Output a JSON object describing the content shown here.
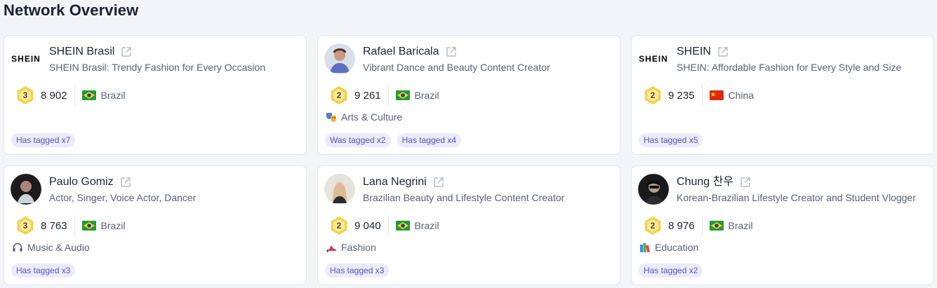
{
  "page": {
    "title": "Network Overview"
  },
  "cards": [
    {
      "name": "SHEIN Brasil",
      "logo_text": "SHEIN",
      "description": "SHEIN Brasil: Trendy Fashion for Every Occasion",
      "rank": "3",
      "score": "8 902",
      "country": "Brazil",
      "flag": "brazil-flag",
      "category": "",
      "tags": [
        "Has tagged x7"
      ]
    },
    {
      "name": "Rafael Baricala",
      "description": "Vibrant Dance and Beauty Content Creator",
      "rank": "2",
      "score": "9 261",
      "country": "Brazil",
      "flag": "brazil-flag",
      "category": "Arts & Culture",
      "category_icon": "theater-masks-icon",
      "tags": [
        "Was tagged x2",
        "Has tagged x4"
      ]
    },
    {
      "name": "SHEIN",
      "logo_text": "SHEIN",
      "description": "SHEIN: Affordable Fashion for Every Style and Size",
      "rank": "2",
      "score": "9 235",
      "country": "China",
      "flag": "china-flag",
      "category": "",
      "tags": [
        "Has tagged x5"
      ]
    },
    {
      "name": "Paulo Gomiz",
      "description": "Actor, Singer, Voice Actor, Dancer",
      "rank": "3",
      "score": "8 763",
      "country": "Brazil",
      "flag": "brazil-flag",
      "category": "Music & Audio",
      "category_icon": "headphones-icon",
      "tags": [
        "Has tagged x3"
      ]
    },
    {
      "name": "Lana Negrini",
      "description": "Brazilian Beauty and Lifestyle Content Creator",
      "rank": "2",
      "score": "9 040",
      "country": "Brazil",
      "flag": "brazil-flag",
      "category": "Fashion",
      "category_icon": "high-heel-icon",
      "tags": [
        "Has tagged x3"
      ]
    },
    {
      "name": "Chung 찬우",
      "description": "Korean-Brazilian Lifestyle Creator and Student Vlogger",
      "rank": "2",
      "score": "8 976",
      "country": "Brazil",
      "flag": "brazil-flag",
      "category": "Education",
      "category_icon": "books-icon",
      "tags": [
        "Has tagged x2"
      ]
    }
  ],
  "colors": {
    "background": "#f3f5f9",
    "tag_bg": "#ecebfb",
    "tag_text": "#5c55b6",
    "badge_gold": "#f3d24b",
    "badge_gold_light": "#fbeaa2"
  }
}
